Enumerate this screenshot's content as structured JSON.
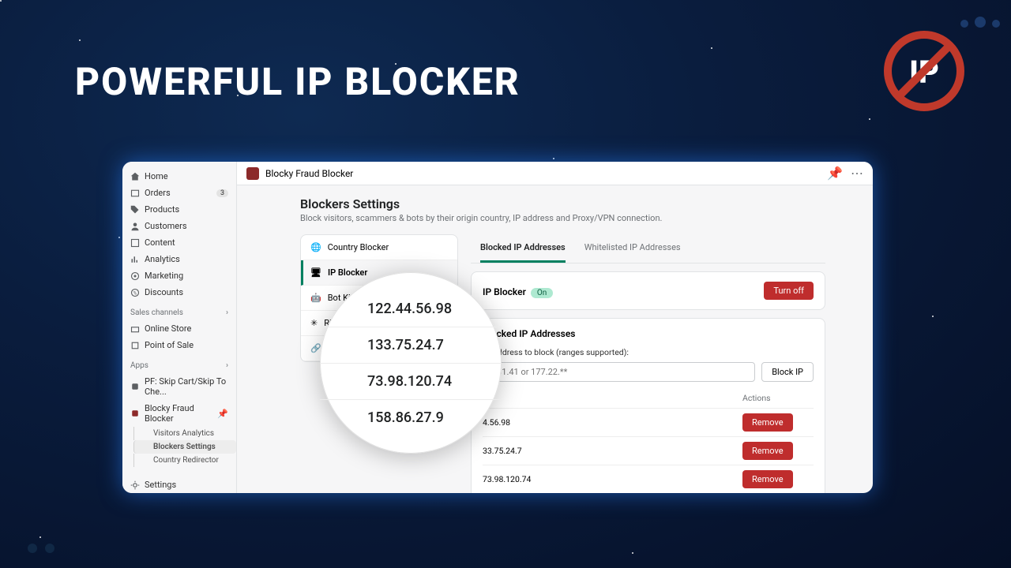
{
  "hero": {
    "title": "POWERFUL IP BLOCKER"
  },
  "sidebar": {
    "nav": [
      {
        "label": "Home",
        "icon": "home"
      },
      {
        "label": "Orders",
        "icon": "orders",
        "badge": "3"
      },
      {
        "label": "Products",
        "icon": "tag"
      },
      {
        "label": "Customers",
        "icon": "person"
      },
      {
        "label": "Content",
        "icon": "content"
      },
      {
        "label": "Analytics",
        "icon": "chart"
      },
      {
        "label": "Marketing",
        "icon": "target"
      },
      {
        "label": "Discounts",
        "icon": "discount"
      }
    ],
    "channels_header": "Sales channels",
    "channels": [
      {
        "label": "Online Store"
      },
      {
        "label": "Point of Sale"
      }
    ],
    "apps_header": "Apps",
    "apps": [
      {
        "label": "PF: Skip Cart/Skip To Che..."
      },
      {
        "label": "Blocky Fraud Blocker",
        "pinned": true,
        "sub": [
          {
            "label": "Visitors Analytics"
          },
          {
            "label": "Blockers Settings",
            "selected": true
          },
          {
            "label": "Country Redirector"
          }
        ]
      }
    ],
    "settings": "Settings"
  },
  "topbar": {
    "title": "Blocky Fraud Blocker"
  },
  "page": {
    "title": "Blockers Settings",
    "subtitle": "Block visitors, scammers & bots by their origin country, IP address and Proxy/VPN connection."
  },
  "side_menu": [
    {
      "label": "Country Blocker"
    },
    {
      "label": "IP Blocker",
      "selected": true
    },
    {
      "label": "Bot Killer"
    },
    {
      "label": "Righ"
    },
    {
      "label": ""
    }
  ],
  "tabs": [
    {
      "label": "Blocked IP Addresses",
      "active": true
    },
    {
      "label": "Whitelisted IP Addresses"
    }
  ],
  "status_card": {
    "title": "IP Blocker",
    "status": "On",
    "button": "Turn off"
  },
  "block_card": {
    "title": "Blocked IP Addresses",
    "hint": "IP Address to block (ranges supported):",
    "placeholder": "2.31.41 or 177.22.**",
    "button": "Block IP",
    "col_address": "ss",
    "col_actions": "Actions",
    "rows": [
      {
        "ip": "4.56.98",
        "full": "122.44.56.98"
      },
      {
        "ip": "33.75.24.7",
        "full": "133.75.24.7"
      },
      {
        "ip": "73.98.120.74",
        "full": "73.98.120.74"
      },
      {
        "ip": "158.86.27.9",
        "full": "158.86.27.9"
      }
    ],
    "remove_label": "Remove"
  },
  "magnifier": [
    "122.44.56.98",
    "133.75.24.7",
    "73.98.120.74",
    "158.86.27.9"
  ]
}
